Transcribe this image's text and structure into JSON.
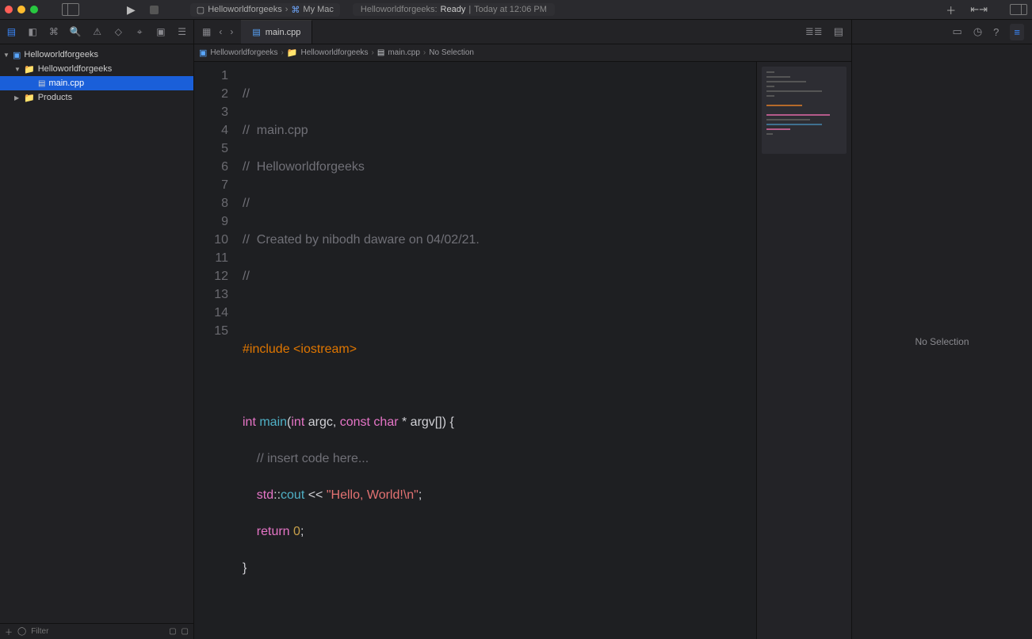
{
  "toolbar": {
    "scheme": "Helloworldforgeeks",
    "destination": "My Mac",
    "status_prefix": "Helloworldforgeeks:",
    "status_ready": "Ready",
    "status_time": "Today at 12:06 PM"
  },
  "nav_tree": {
    "project": "Helloworldforgeeks",
    "group": "Helloworldforgeeks",
    "source_file": "main.cpp",
    "products": "Products"
  },
  "nav_filter_placeholder": "Filter",
  "tab": {
    "label": "main.cpp"
  },
  "jumpbar": {
    "crumb1": "Helloworldforgeeks",
    "crumb2": "Helloworldforgeeks",
    "crumb3": "main.cpp",
    "crumb4": "No Selection"
  },
  "code": {
    "l1": "//",
    "l2_a": "//  ",
    "l2_b": "main.cpp",
    "l3_a": "//  ",
    "l3_b": "Helloworldforgeeks",
    "l4": "//",
    "l5_a": "//  ",
    "l5_b": "Created by nibodh daware on 04/02/21.",
    "l6": "//",
    "l7": "",
    "l8_a": "#include",
    "l8_b": " <iostream>",
    "l9": "",
    "l10_int": "int",
    "l10_main": " main",
    "l10_open": "(",
    "l10_arg_int": "int",
    "l10_argc": " argc, ",
    "l10_const": "const",
    "l10_char": " char",
    "l10_rest": " * argv[]) {",
    "l11": "    // insert code here...",
    "l12_std": "    std",
    "l12_sep": "::",
    "l12_cout": "cout",
    "l12_op": " << ",
    "l12_str": "\"Hello, World!\\n\"",
    "l12_end": ";",
    "l13_ret": "    return",
    "l13_sp": " ",
    "l13_zero": "0",
    "l13_end": ";",
    "l14": "}",
    "l15": ""
  },
  "line_numbers": [
    "1",
    "2",
    "3",
    "4",
    "5",
    "6",
    "7",
    "8",
    "9",
    "10",
    "11",
    "12",
    "13",
    "14",
    "15"
  ],
  "inspector": {
    "empty_text": "No Selection"
  }
}
